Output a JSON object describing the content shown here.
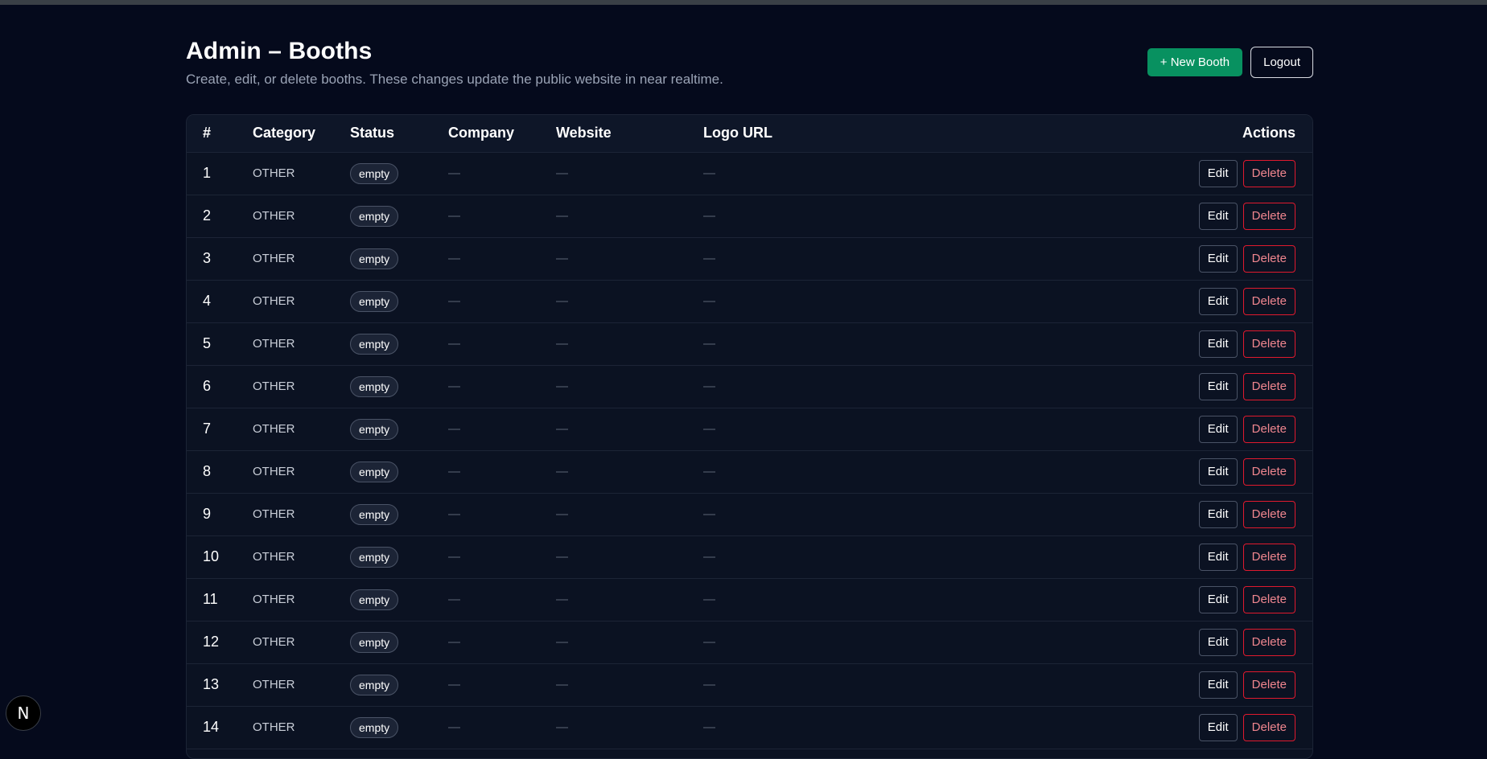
{
  "header": {
    "title": "Admin – Booths",
    "subtitle": "Create, edit, or delete booths. These changes update the public website in near realtime.",
    "new_button": "+ New Booth",
    "logout_button": "Logout"
  },
  "table": {
    "columns": [
      "#",
      "Category",
      "Status",
      "Company",
      "Website",
      "Logo URL",
      "Actions"
    ],
    "edit_label": "Edit",
    "delete_label": "Delete",
    "rows": [
      {
        "num": "1",
        "category": "OTHER",
        "status": "empty",
        "company": "—",
        "website": "—",
        "logo": "—"
      },
      {
        "num": "2",
        "category": "OTHER",
        "status": "empty",
        "company": "—",
        "website": "—",
        "logo": "—"
      },
      {
        "num": "3",
        "category": "OTHER",
        "status": "empty",
        "company": "—",
        "website": "—",
        "logo": "—"
      },
      {
        "num": "4",
        "category": "OTHER",
        "status": "empty",
        "company": "—",
        "website": "—",
        "logo": "—"
      },
      {
        "num": "5",
        "category": "OTHER",
        "status": "empty",
        "company": "—",
        "website": "—",
        "logo": "—"
      },
      {
        "num": "6",
        "category": "OTHER",
        "status": "empty",
        "company": "—",
        "website": "—",
        "logo": "—"
      },
      {
        "num": "7",
        "category": "OTHER",
        "status": "empty",
        "company": "—",
        "website": "—",
        "logo": "—"
      },
      {
        "num": "8",
        "category": "OTHER",
        "status": "empty",
        "company": "—",
        "website": "—",
        "logo": "—"
      },
      {
        "num": "9",
        "category": "OTHER",
        "status": "empty",
        "company": "—",
        "website": "—",
        "logo": "—"
      },
      {
        "num": "10",
        "category": "OTHER",
        "status": "empty",
        "company": "—",
        "website": "—",
        "logo": "—"
      },
      {
        "num": "11",
        "category": "OTHER",
        "status": "empty",
        "company": "—",
        "website": "—",
        "logo": "—"
      },
      {
        "num": "12",
        "category": "OTHER",
        "status": "empty",
        "company": "—",
        "website": "—",
        "logo": "—"
      },
      {
        "num": "13",
        "category": "OTHER",
        "status": "empty",
        "company": "—",
        "website": "—",
        "logo": "—"
      },
      {
        "num": "14",
        "category": "OTHER",
        "status": "empty",
        "company": "—",
        "website": "—",
        "logo": "—"
      }
    ]
  },
  "dev_indicator": {
    "letter": "N",
    "icon": "nextjs-logo-icon"
  },
  "colors": {
    "background": "#050a1c",
    "primary_button": "#089160",
    "danger": "#e01a2e"
  }
}
